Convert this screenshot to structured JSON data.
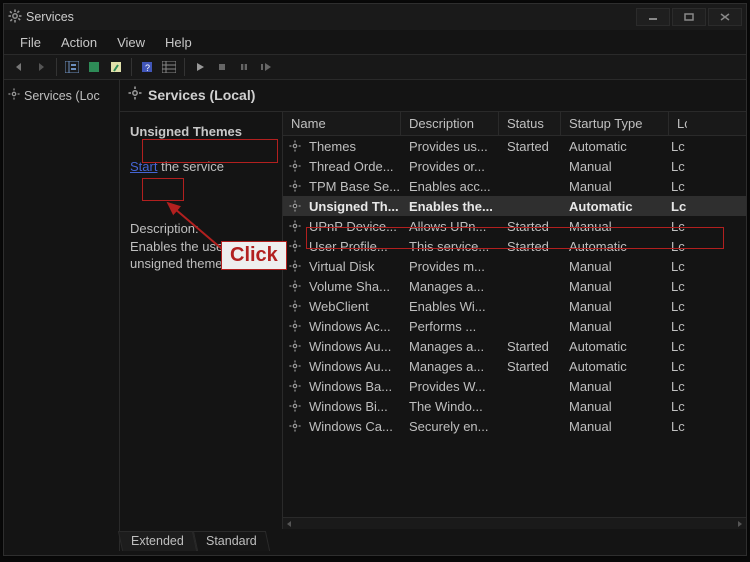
{
  "window": {
    "title": "Services"
  },
  "menu": {
    "file": "File",
    "action": "Action",
    "view": "View",
    "help": "Help"
  },
  "tree": {
    "root": "Services (Loc"
  },
  "header": {
    "title": "Services (Local)"
  },
  "info": {
    "selected_name": "Unsigned Themes",
    "start_link": "Start",
    "start_rest": " the service",
    "desc_label": "Description:",
    "desc_text": "Enables the use of unsigned themes."
  },
  "columns": {
    "name": "Name",
    "desc": "Description",
    "status": "Status",
    "type": "Startup Type",
    "last": "Lc"
  },
  "rows": [
    {
      "name": "Themes",
      "desc": "Provides us...",
      "status": "Started",
      "type": "Automatic",
      "last": "Lc"
    },
    {
      "name": "Thread Orde...",
      "desc": "Provides or...",
      "status": "",
      "type": "Manual",
      "last": "Lc"
    },
    {
      "name": "TPM Base Se...",
      "desc": "Enables acc...",
      "status": "",
      "type": "Manual",
      "last": "Lc"
    },
    {
      "name": "Unsigned Th...",
      "desc": "Enables the...",
      "status": "",
      "type": "Automatic",
      "last": "Lc",
      "selected": true
    },
    {
      "name": "UPnP Device...",
      "desc": "Allows UPn...",
      "status": "Started",
      "type": "Manual",
      "last": "Lc"
    },
    {
      "name": "User Profile...",
      "desc": "This service...",
      "status": "Started",
      "type": "Automatic",
      "last": "Lc"
    },
    {
      "name": "Virtual Disk",
      "desc": "Provides m...",
      "status": "",
      "type": "Manual",
      "last": "Lc"
    },
    {
      "name": "Volume Sha...",
      "desc": "Manages a...",
      "status": "",
      "type": "Manual",
      "last": "Lc"
    },
    {
      "name": "WebClient",
      "desc": "Enables Wi...",
      "status": "",
      "type": "Manual",
      "last": "Lc"
    },
    {
      "name": "Windows Ac...",
      "desc": "Performs ...",
      "status": "",
      "type": "Manual",
      "last": "Lc"
    },
    {
      "name": "Windows Au...",
      "desc": "Manages a...",
      "status": "Started",
      "type": "Automatic",
      "last": "Lc"
    },
    {
      "name": "Windows Au...",
      "desc": "Manages a...",
      "status": "Started",
      "type": "Automatic",
      "last": "Lc"
    },
    {
      "name": "Windows Ba...",
      "desc": "Provides W...",
      "status": "",
      "type": "Manual",
      "last": "Lc"
    },
    {
      "name": "Windows Bi...",
      "desc": "The Windo...",
      "status": "",
      "type": "Manual",
      "last": "Lc"
    },
    {
      "name": "Windows Ca...",
      "desc": "Securely en...",
      "status": "",
      "type": "Manual",
      "last": "Lc"
    }
  ],
  "tabs": {
    "extended": "Extended",
    "standard": "Standard"
  },
  "annotation": {
    "click": "Click"
  }
}
